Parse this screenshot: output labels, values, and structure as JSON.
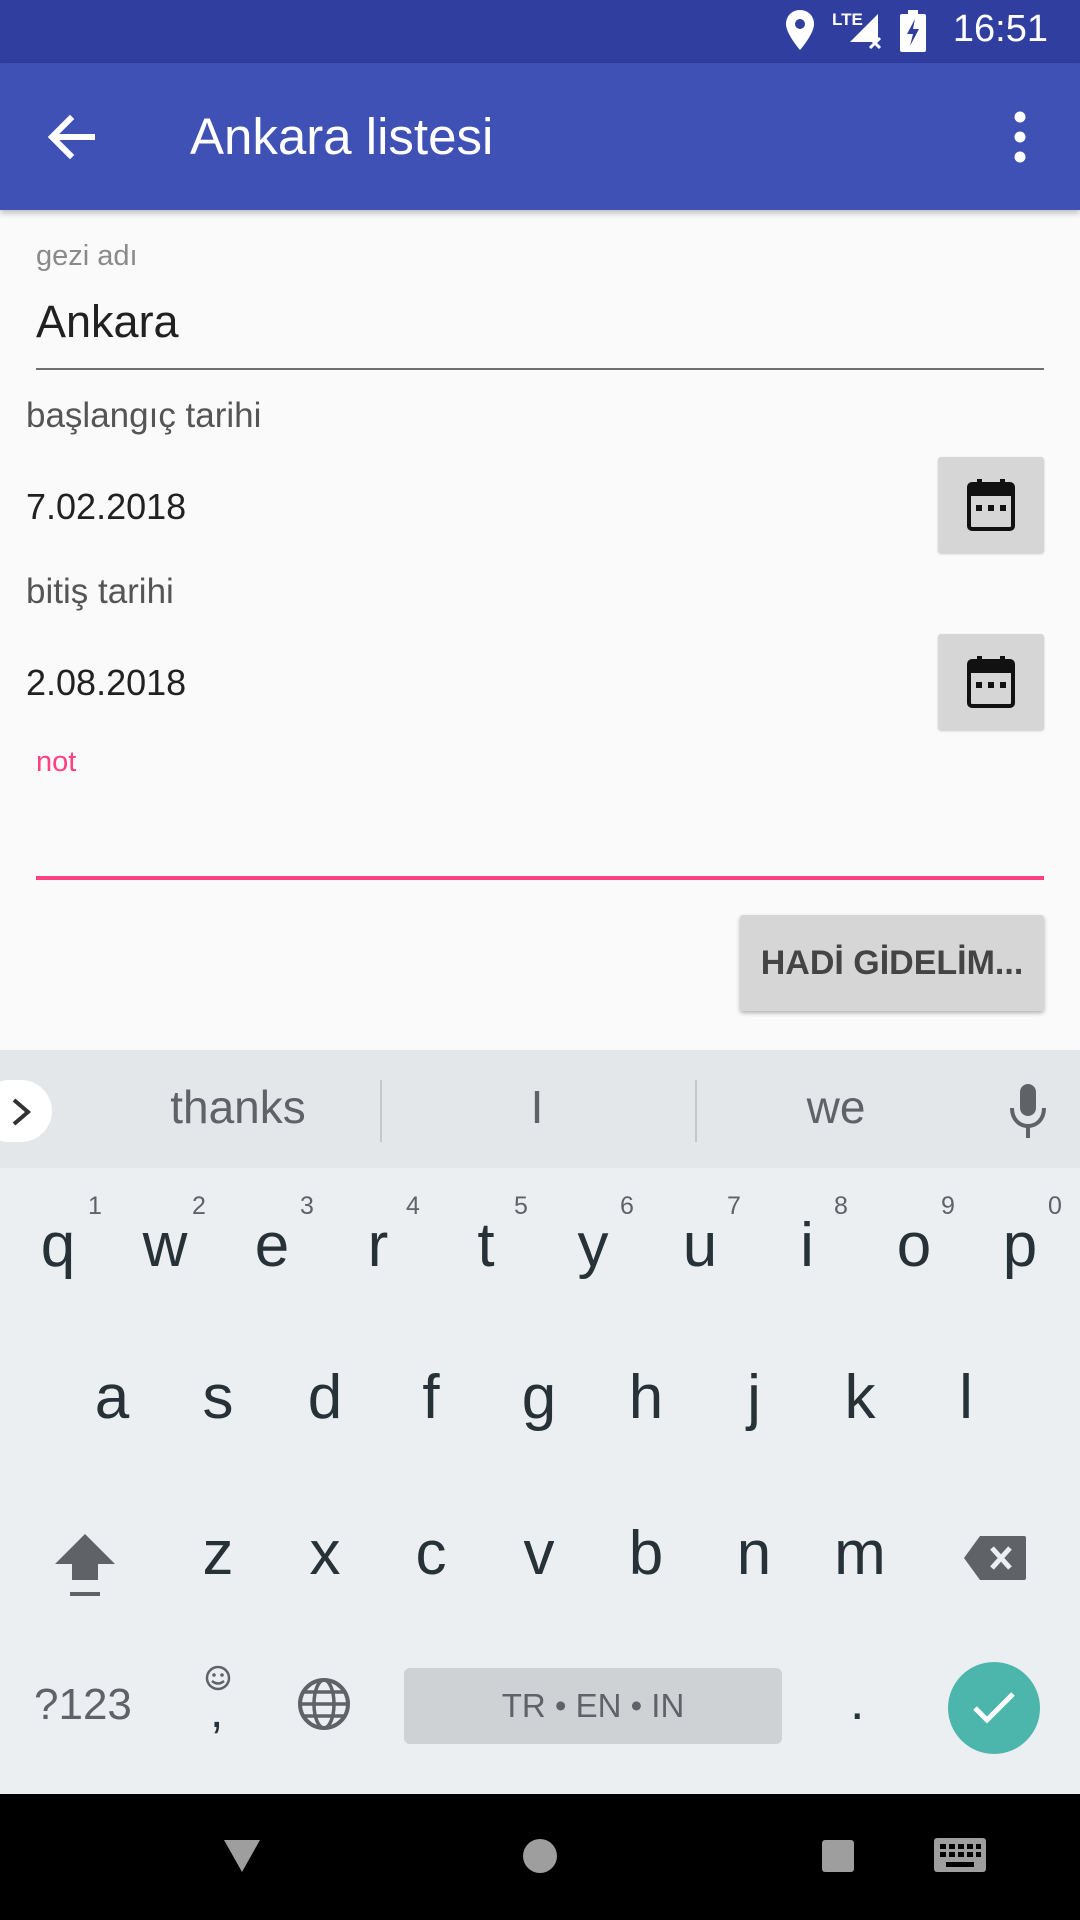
{
  "status_bar": {
    "time": "16:51",
    "network_label": "LTE",
    "icons": [
      "location-icon",
      "signal-icon",
      "battery-charging-icon"
    ]
  },
  "app_bar": {
    "title": "Ankara listesi",
    "back_icon": "arrow-back-icon",
    "menu_icon": "more-vert-icon"
  },
  "form": {
    "trip_name": {
      "label": "gezi adı",
      "value": "Ankara"
    },
    "start_date": {
      "label": "başlangıç tarihi",
      "value": "7.02.2018",
      "icon": "calendar-icon"
    },
    "end_date": {
      "label": "bitiş tarihi",
      "value": "2.08.2018",
      "icon": "calendar-icon"
    },
    "note": {
      "label": "not",
      "value": ""
    },
    "submit_label": "HADİ GİDELİM...",
    "accent_color": "#ff4081"
  },
  "keyboard": {
    "suggestions": [
      "thanks",
      "I",
      "we"
    ],
    "row1": [
      "q",
      "w",
      "e",
      "r",
      "t",
      "y",
      "u",
      "i",
      "o",
      "p"
    ],
    "row1_hints": [
      "1",
      "2",
      "3",
      "4",
      "5",
      "6",
      "7",
      "8",
      "9",
      "0"
    ],
    "row2": [
      "a",
      "s",
      "d",
      "f",
      "g",
      "h",
      "j",
      "k",
      "l"
    ],
    "row3": [
      "z",
      "x",
      "c",
      "v",
      "b",
      "n",
      "m"
    ],
    "symbols_label": "?123",
    "comma_label": ",",
    "period_label": ".",
    "space_label": "TR • EN • IN",
    "accent_color": "#4db6ac"
  },
  "nav_bar": {
    "icons": [
      "back-triangle-icon",
      "home-circle-icon",
      "recents-square-icon",
      "keyboard-switch-icon"
    ]
  }
}
